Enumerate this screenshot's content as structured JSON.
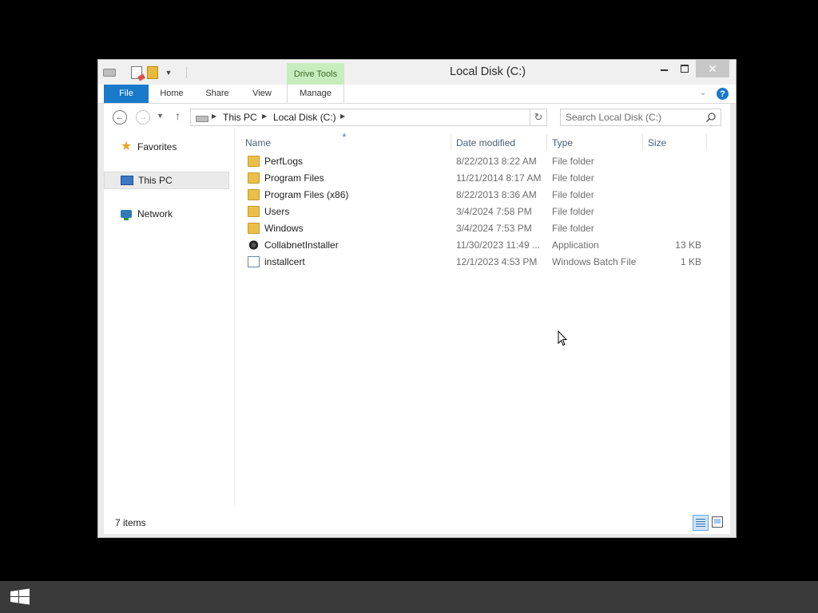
{
  "window": {
    "title": "Local Disk (C:)",
    "context_tab_group": "Drive Tools"
  },
  "ribbon": {
    "tabs": [
      "File",
      "Home",
      "Share",
      "View",
      "Manage"
    ],
    "help": "?"
  },
  "navigation": {
    "breadcrumb": [
      "This PC",
      "Local Disk (C:)"
    ],
    "search_placeholder": "Search Local Disk (C:)"
  },
  "nav_pane": {
    "items": [
      {
        "label": "Favorites",
        "icon": "star-icon"
      },
      {
        "label": "This PC",
        "icon": "computer-icon",
        "selected": true
      },
      {
        "label": "Network",
        "icon": "network-icon"
      }
    ]
  },
  "file_list": {
    "columns": [
      "Name",
      "Date modified",
      "Type",
      "Size"
    ],
    "rows": [
      {
        "name": "PerfLogs",
        "date": "8/22/2013 8:22 AM",
        "type": "File folder",
        "size": "",
        "icon": "folder-icon"
      },
      {
        "name": "Program Files",
        "date": "11/21/2014 8:17 AM",
        "type": "File folder",
        "size": "",
        "icon": "folder-icon"
      },
      {
        "name": "Program Files (x86)",
        "date": "8/22/2013 8:36 AM",
        "type": "File folder",
        "size": "",
        "icon": "folder-icon"
      },
      {
        "name": "Users",
        "date": "3/4/2024 7:58 PM",
        "type": "File folder",
        "size": "",
        "icon": "folder-icon"
      },
      {
        "name": "Windows",
        "date": "3/4/2024 7:53 PM",
        "type": "File folder",
        "size": "",
        "icon": "folder-icon"
      },
      {
        "name": "CollabnetInstaller",
        "date": "11/30/2023 11:49 ...",
        "type": "Application",
        "size": "13 KB",
        "icon": "application-icon"
      },
      {
        "name": "installcert",
        "date": "12/1/2023 4:53 PM",
        "type": "Windows Batch File",
        "size": "1 KB",
        "icon": "batch-file-icon"
      }
    ]
  },
  "status": {
    "item_count": "7 items"
  },
  "colors": {
    "accent": "#1979ca",
    "context_tab": "#c7edbc",
    "taskbar": "#3a3a3a",
    "desktop": "#000000"
  }
}
